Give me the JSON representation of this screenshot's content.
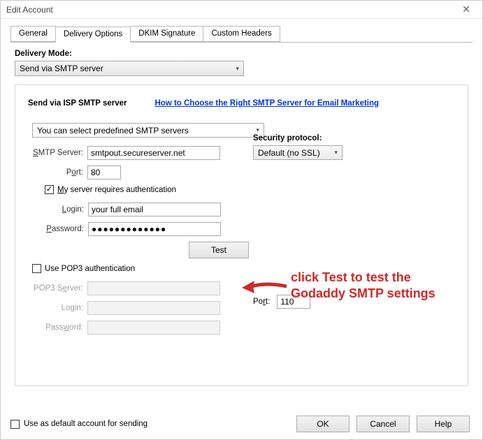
{
  "window": {
    "title": "Edit Account"
  },
  "tabs": {
    "general": "General",
    "delivery": "Delivery Options",
    "dkim": "DKIM Signature",
    "custom": "Custom Headers"
  },
  "deliveryMode": {
    "label": "Delivery Mode:",
    "value": "Send via SMTP server"
  },
  "group": {
    "title": "Send via ISP SMTP server",
    "helpLink": "How to Choose the Right SMTP Server for Email Marketing",
    "predefValue": "You can select predefined SMTP servers"
  },
  "fields": {
    "smtpServerLabel": "SMTP Server:",
    "smtpServerValue": "smtpout.secureserver.net",
    "portLabel": "Port:",
    "portValue": "80",
    "securityLabel": "Security protocol:",
    "securityValue": "Default (no SSL)",
    "authCheckLabel": "My server requires authentication",
    "loginLabel": "Login:",
    "loginValue": "your full email",
    "passwordLabel": "Password:",
    "passwordValue": "●●●●●●●●●●●●●",
    "testBtn": "Test",
    "pop3CheckLabel": "Use POP3 authentication",
    "pop3ServerLabel": "POP3 Server:",
    "pop3ServerValue": "",
    "pop3PortLabel": "Port:",
    "pop3PortValue": "110",
    "pop3LoginLabel": "Login:",
    "pop3LoginValue": "",
    "pop3PasswordLabel": "Password:",
    "pop3PasswordValue": ""
  },
  "footer": {
    "defaultCheck": "Use as default account for sending",
    "ok": "OK",
    "cancel": "Cancel",
    "help": "Help"
  },
  "annotation": {
    "line1": "click Test to test the",
    "line2": "Godaddy SMTP settings"
  }
}
